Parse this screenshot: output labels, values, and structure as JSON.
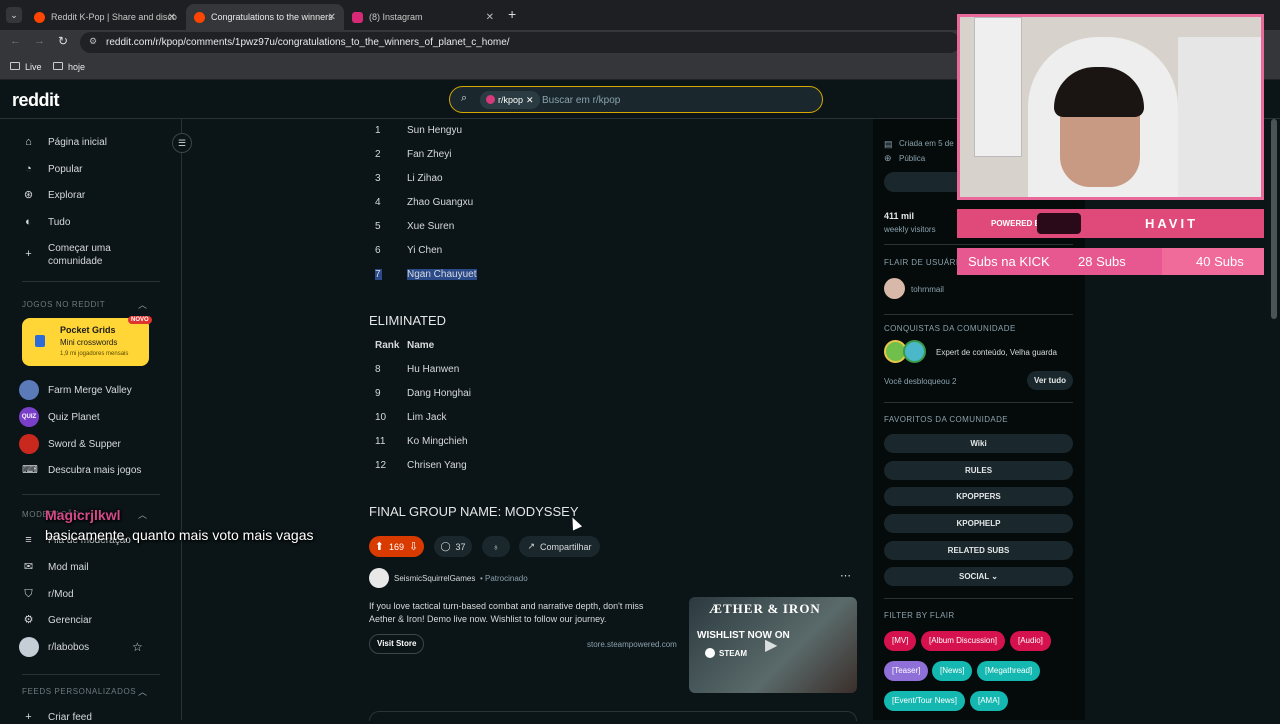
{
  "browser": {
    "tabs": [
      {
        "title": "Reddit K-Pop | Share and disco",
        "active": false
      },
      {
        "title": "Congratulations to the winners",
        "active": true
      },
      {
        "title": "(8) Instagram",
        "active": false
      }
    ],
    "url": "reddit.com/r/kpop/comments/1pwz97u/congratulations_to_the_winners_of_planet_c_home/",
    "bookmarks": [
      "Live",
      "hoje"
    ]
  },
  "header": {
    "logo": "reddit",
    "search_chip": "r/kpop",
    "search_placeholder": "Buscar em r/kpop"
  },
  "sidebar": {
    "items": [
      {
        "label": "Página inicial",
        "icon": "home-icon"
      },
      {
        "label": "Popular",
        "icon": "popular-icon"
      },
      {
        "label": "Explorar",
        "icon": "explore-icon"
      },
      {
        "label": "Tudo",
        "icon": "all-icon"
      },
      {
        "label": "Começar uma comunidade",
        "icon": "plus-icon"
      }
    ],
    "games_title": "JOGOS NO REDDIT",
    "pocket": {
      "title": "Pocket Grids",
      "subtitle": "Mini crosswords",
      "meta": "1,9 mi jogadores mensais",
      "badge": "NOVO"
    },
    "games": [
      "Farm Merge Valley",
      "Quiz Planet",
      "Sword & Supper",
      "Descubra mais jogos"
    ],
    "mod_title": "MODERAÇÃO",
    "mod_items": [
      "Fila de moderação",
      "Mod mail",
      "r/Mod",
      "Gerenciar",
      "r/labobos"
    ],
    "feeds_title": "FEEDS PERSONALIZADOS",
    "feeds_item": "Criar feed"
  },
  "post": {
    "winners": [
      {
        "n": "1",
        "name": "Sun Hengyu"
      },
      {
        "n": "2",
        "name": "Fan Zheyi"
      },
      {
        "n": "3",
        "name": "Li Zihao"
      },
      {
        "n": "4",
        "name": "Zhao Guangxu"
      },
      {
        "n": "5",
        "name": "Xue Suren"
      },
      {
        "n": "6",
        "name": "Yi Chen"
      },
      {
        "n": "7",
        "name": "Ngan Chauyuet"
      }
    ],
    "eliminated_title": "ELIMINATED",
    "col_rank": "Rank",
    "col_name": "Name",
    "eliminated": [
      {
        "n": "8",
        "name": "Hu Hanwen"
      },
      {
        "n": "9",
        "name": "Dang Honghai"
      },
      {
        "n": "10",
        "name": "Lim Jack"
      },
      {
        "n": "11",
        "name": "Ko Mingchieh"
      },
      {
        "n": "12",
        "name": "Chrisen Yang"
      }
    ],
    "group_name": "FINAL GROUP NAME: MODYSSEY",
    "votes": "169",
    "comments": "37",
    "share": "Compartilhar"
  },
  "ad": {
    "author": "SeismicSquirrelGames",
    "sponsored": "Patrocinado",
    "text": "If you love tactical turn-based combat and narrative depth, don't miss Aether & Iron! Demo live now. Wishlist to follow our journey.",
    "button": "Visit Store",
    "domain": "store.steampowered.com",
    "image_title": "ÆTHER & IRON",
    "image_line1": "WISHLIST NOW ON",
    "image_line2": "STEAM"
  },
  "right": {
    "created": "Criada em 5 de",
    "public": "Pública",
    "visitors_value": "411 mil",
    "visitors_label": "weekly visitors",
    "flair_title": "FLAIR DE USUÁRIO",
    "flair_user": "tohrnmail",
    "achievements_title": "CONQUISTAS DA COMUNIDADE",
    "achievements_text": "Expert de conteúdo, Velha guarda",
    "unlocked": "Você desbloqueou 2",
    "see_all": "Ver tudo",
    "favorites_title": "FAVORITOS DA COMUNIDADE",
    "favorites": [
      "Wiki",
      "RULES",
      "KPOPPERS",
      "KPOPHELP",
      "RELATED SUBS",
      "SOCIAL"
    ],
    "filter_title": "FILTER BY FLAIR",
    "flairs": [
      {
        "label": "[MV]",
        "color": "#d6124e"
      },
      {
        "label": "[Album Discussion]",
        "color": "#d6124e"
      },
      {
        "label": "[Audio]",
        "color": "#d6124e"
      },
      {
        "label": "[Teaser]",
        "color": "#8f6fd8"
      },
      {
        "label": "[News]",
        "color": "#14b8b0"
      },
      {
        "label": "[Megathread]",
        "color": "#14b8b0"
      },
      {
        "label": "[Event/Tour News]",
        "color": "#14b8b0"
      },
      {
        "label": "[AMA]",
        "color": "#14b8b0"
      }
    ]
  },
  "stream": {
    "powered_by": "POWERED BY",
    "brand2": "HAVIT",
    "subs_label": "Subs na KICK",
    "subs_current": "28 Subs",
    "subs_goal": "40 Subs",
    "chat_user": "Magicrjlkwl",
    "chat_message": "basicamente, quanto mais voto mais vagas"
  }
}
